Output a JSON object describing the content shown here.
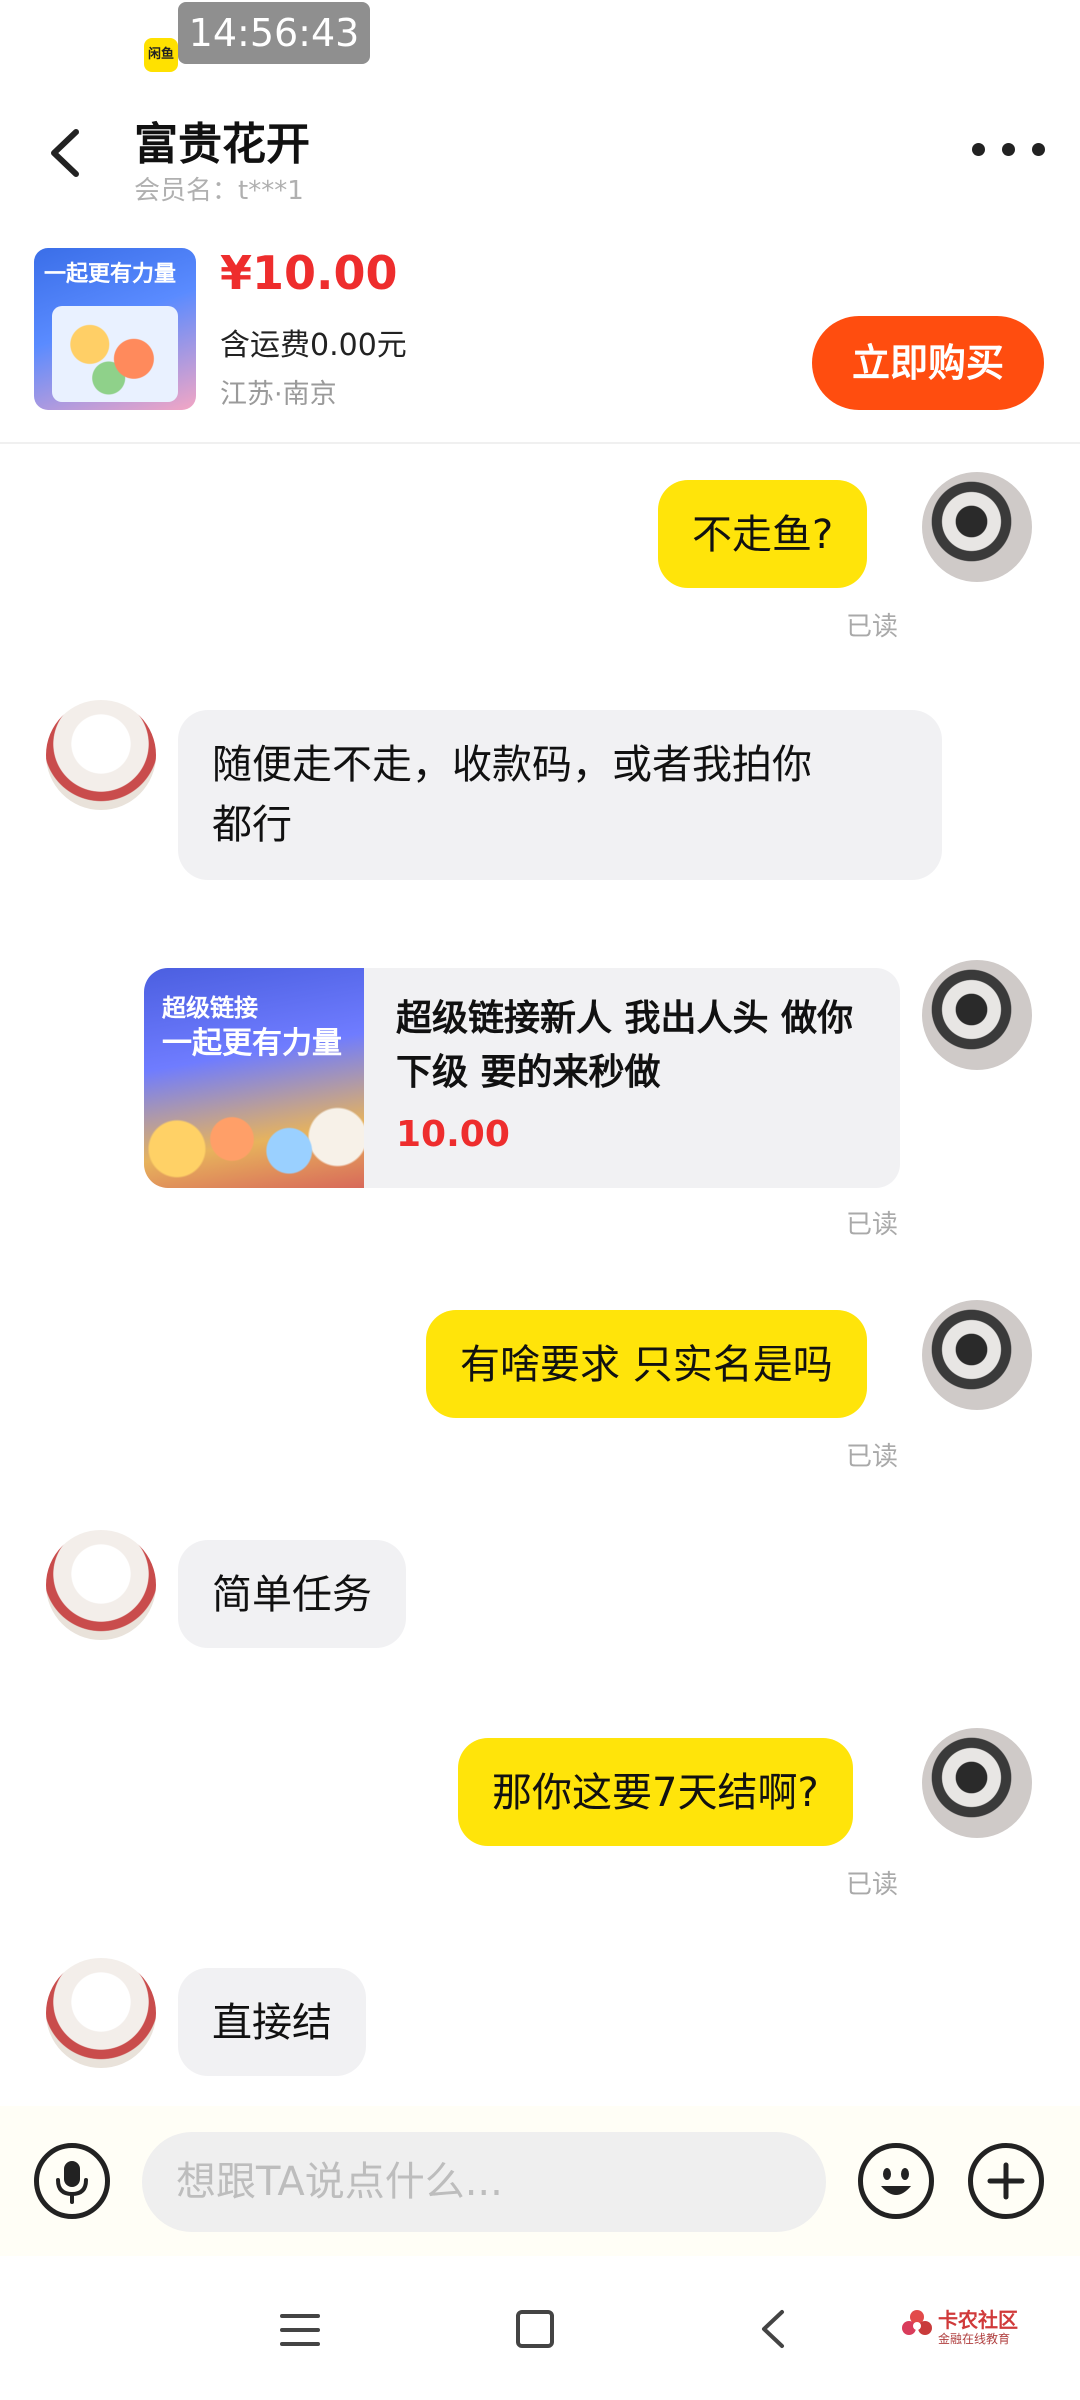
{
  "status_bar": {
    "time": "14:56:43",
    "app_badge": "闲鱼"
  },
  "header": {
    "title": "富贵花开",
    "member": "会员名：t***1"
  },
  "product": {
    "thumb_text": "一起更有力量",
    "price": "¥10.00",
    "shipping": "含运费0.00元",
    "location": "江苏·南京",
    "buy_label": "立即购买"
  },
  "messages": [
    {
      "from": "me",
      "text": "不走鱼?",
      "status": "已读"
    },
    {
      "from": "other",
      "text": [
        "随便走不走，收款码，或者我拍你",
        "都行"
      ]
    },
    {
      "from": "me",
      "type": "item",
      "image_text": [
        "超级链接",
        "一起更有力量"
      ],
      "title": "超级链接新人 我出人头 做你下级 要的来秒做",
      "price": "10.00",
      "status": "已读"
    },
    {
      "from": "me",
      "text": "有啥要求 只实名是吗",
      "status": "已读"
    },
    {
      "from": "other",
      "text": "简单任务"
    },
    {
      "from": "me",
      "text": "那你这要7天结啊?",
      "status": "已读"
    },
    {
      "from": "other",
      "text": "直接结"
    }
  ],
  "input": {
    "placeholder": "想跟TA说点什么..."
  },
  "icons": {
    "back": "chevron-left-icon",
    "more": "more-dots-icon",
    "mic": "microphone-icon",
    "emoji": "smiley-icon",
    "plus": "plus-icon",
    "nav_menu": "menu-icon",
    "nav_home": "home-square-icon",
    "nav_back": "nav-back-icon"
  },
  "watermark": {
    "title": "卡农社区",
    "subtitle": "金融在线教育"
  },
  "colors": {
    "accent_yellow": "#ffe40a",
    "buy_orange": "#ff4d0f",
    "price_red": "#ee2d2d"
  }
}
